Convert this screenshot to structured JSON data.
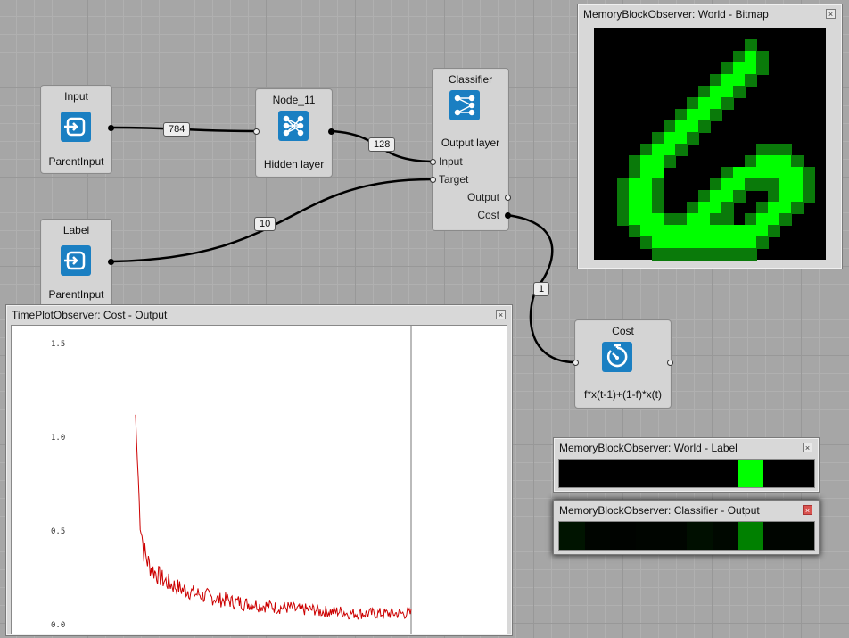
{
  "nodes": {
    "input": {
      "title": "Input",
      "subtitle": "ParentInput",
      "icon": "input-icon"
    },
    "label": {
      "title": "Label",
      "subtitle": "ParentInput",
      "icon": "input-icon"
    },
    "node11": {
      "title": "Node_11",
      "subtitle": "Hidden layer",
      "icon": "hidden-layer-icon"
    },
    "classifier": {
      "title": "Classifier",
      "subtitle": "Output layer",
      "icon": "output-layer-icon",
      "ports": {
        "input": "Input",
        "target": "Target",
        "output": "Output",
        "cost": "Cost"
      }
    },
    "cost": {
      "title": "Cost",
      "subtitle": "f*x(t-1)+(1-f)*x(t)",
      "icon": "timer-icon"
    }
  },
  "connections": {
    "input_to_node11": "784",
    "node11_to_classifier": "128",
    "label_to_classifier": "10",
    "classifier_to_cost": "1"
  },
  "windows": {
    "bitmap": {
      "title": "MemoryBlockObserver: World - Bitmap"
    },
    "label": {
      "title": "MemoryBlockObserver: World - Label",
      "cells": [
        0,
        0,
        0,
        0,
        0,
        0,
        0,
        1,
        0,
        0
      ],
      "color": "#00ff00"
    },
    "output": {
      "title": "MemoryBlockObserver: Classifier - Output",
      "cells": [
        0.08,
        0.02,
        0.01,
        0.02,
        0.02,
        0.06,
        0.03,
        0.5,
        0.02,
        0.02
      ],
      "color": "#00ff00"
    },
    "timeplot": {
      "title": "TimePlotObserver: Cost - Output",
      "close": "x"
    }
  },
  "chart_data": {
    "type": "line",
    "title": "",
    "xlabel": "",
    "ylabel": "",
    "tick_labels": [
      "1.5",
      "1.0",
      "0.5",
      "0.0"
    ],
    "ylim": [
      0,
      1.5
    ],
    "series": [
      {
        "color": "#cc0000",
        "x_start": 0,
        "x_end": 310,
        "start_value": 1.12,
        "values": [
          1.12,
          0.58,
          0.38,
          0.32,
          0.28,
          0.26,
          0.24,
          0.22,
          0.21,
          0.2,
          0.19,
          0.18,
          0.17,
          0.17,
          0.16,
          0.15,
          0.15,
          0.14,
          0.14,
          0.13,
          0.13,
          0.12,
          0.12,
          0.12,
          0.11,
          0.11,
          0.11,
          0.1,
          0.1,
          0.1,
          0.1,
          0.09,
          0.09,
          0.09,
          0.09,
          0.08,
          0.08,
          0.08,
          0.08,
          0.08,
          0.07,
          0.07,
          0.07,
          0.07,
          0.07,
          0.07,
          0.06,
          0.06,
          0.06,
          0.06,
          0.06,
          0.06,
          0.06,
          0.05,
          0.05,
          0.05,
          0.05,
          0.05,
          0.05,
          0.05,
          0.05,
          0.05,
          0.05,
          0.05,
          0.05,
          0.05,
          0.05,
          0.05,
          0.05,
          0.05
        ]
      }
    ]
  },
  "bitmap_pixels": [
    "00000000000000000000",
    "00000000000003000000",
    "00000000000039300000",
    "00000000000399300000",
    "00000000003993000000",
    "00000000039930000000",
    "00000000399300000000",
    "00000003993000000000",
    "00000039930000000000",
    "00000399300000000000",
    "00003993000000333000",
    "00039930000003999300",
    "00039900000399999930",
    "00399300003993339930",
    "00399300039930039930",
    "00399300399300399300",
    "00399933993303993000",
    "00039999999999930000",
    "00003999999999300000",
    "00000333333333000000"
  ]
}
